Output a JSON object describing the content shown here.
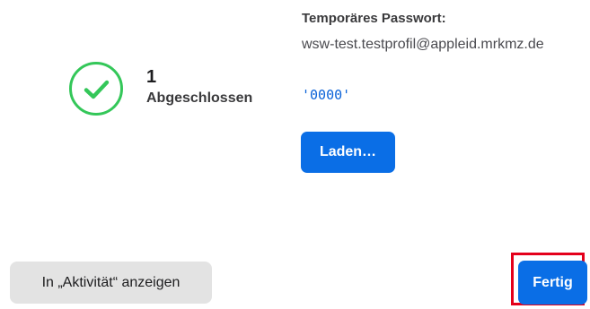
{
  "status": {
    "count": "1",
    "label": "Abgeschlossen",
    "icon": "checkmark-circle-icon",
    "success_color": "#34c759"
  },
  "credentials": {
    "title": "Temporäres Passwort:",
    "email": "wsw-test.testprofil@appleid.mrkmz.de",
    "password": "'0000'",
    "password_color": "#0a62d8"
  },
  "actions": {
    "load_label": "Laden…",
    "show_in_activity_label": "In „Aktivität“ anzeigen",
    "done_label": "Fertig",
    "primary_color": "#0a6ee6",
    "highlight_color": "#e4001b"
  }
}
